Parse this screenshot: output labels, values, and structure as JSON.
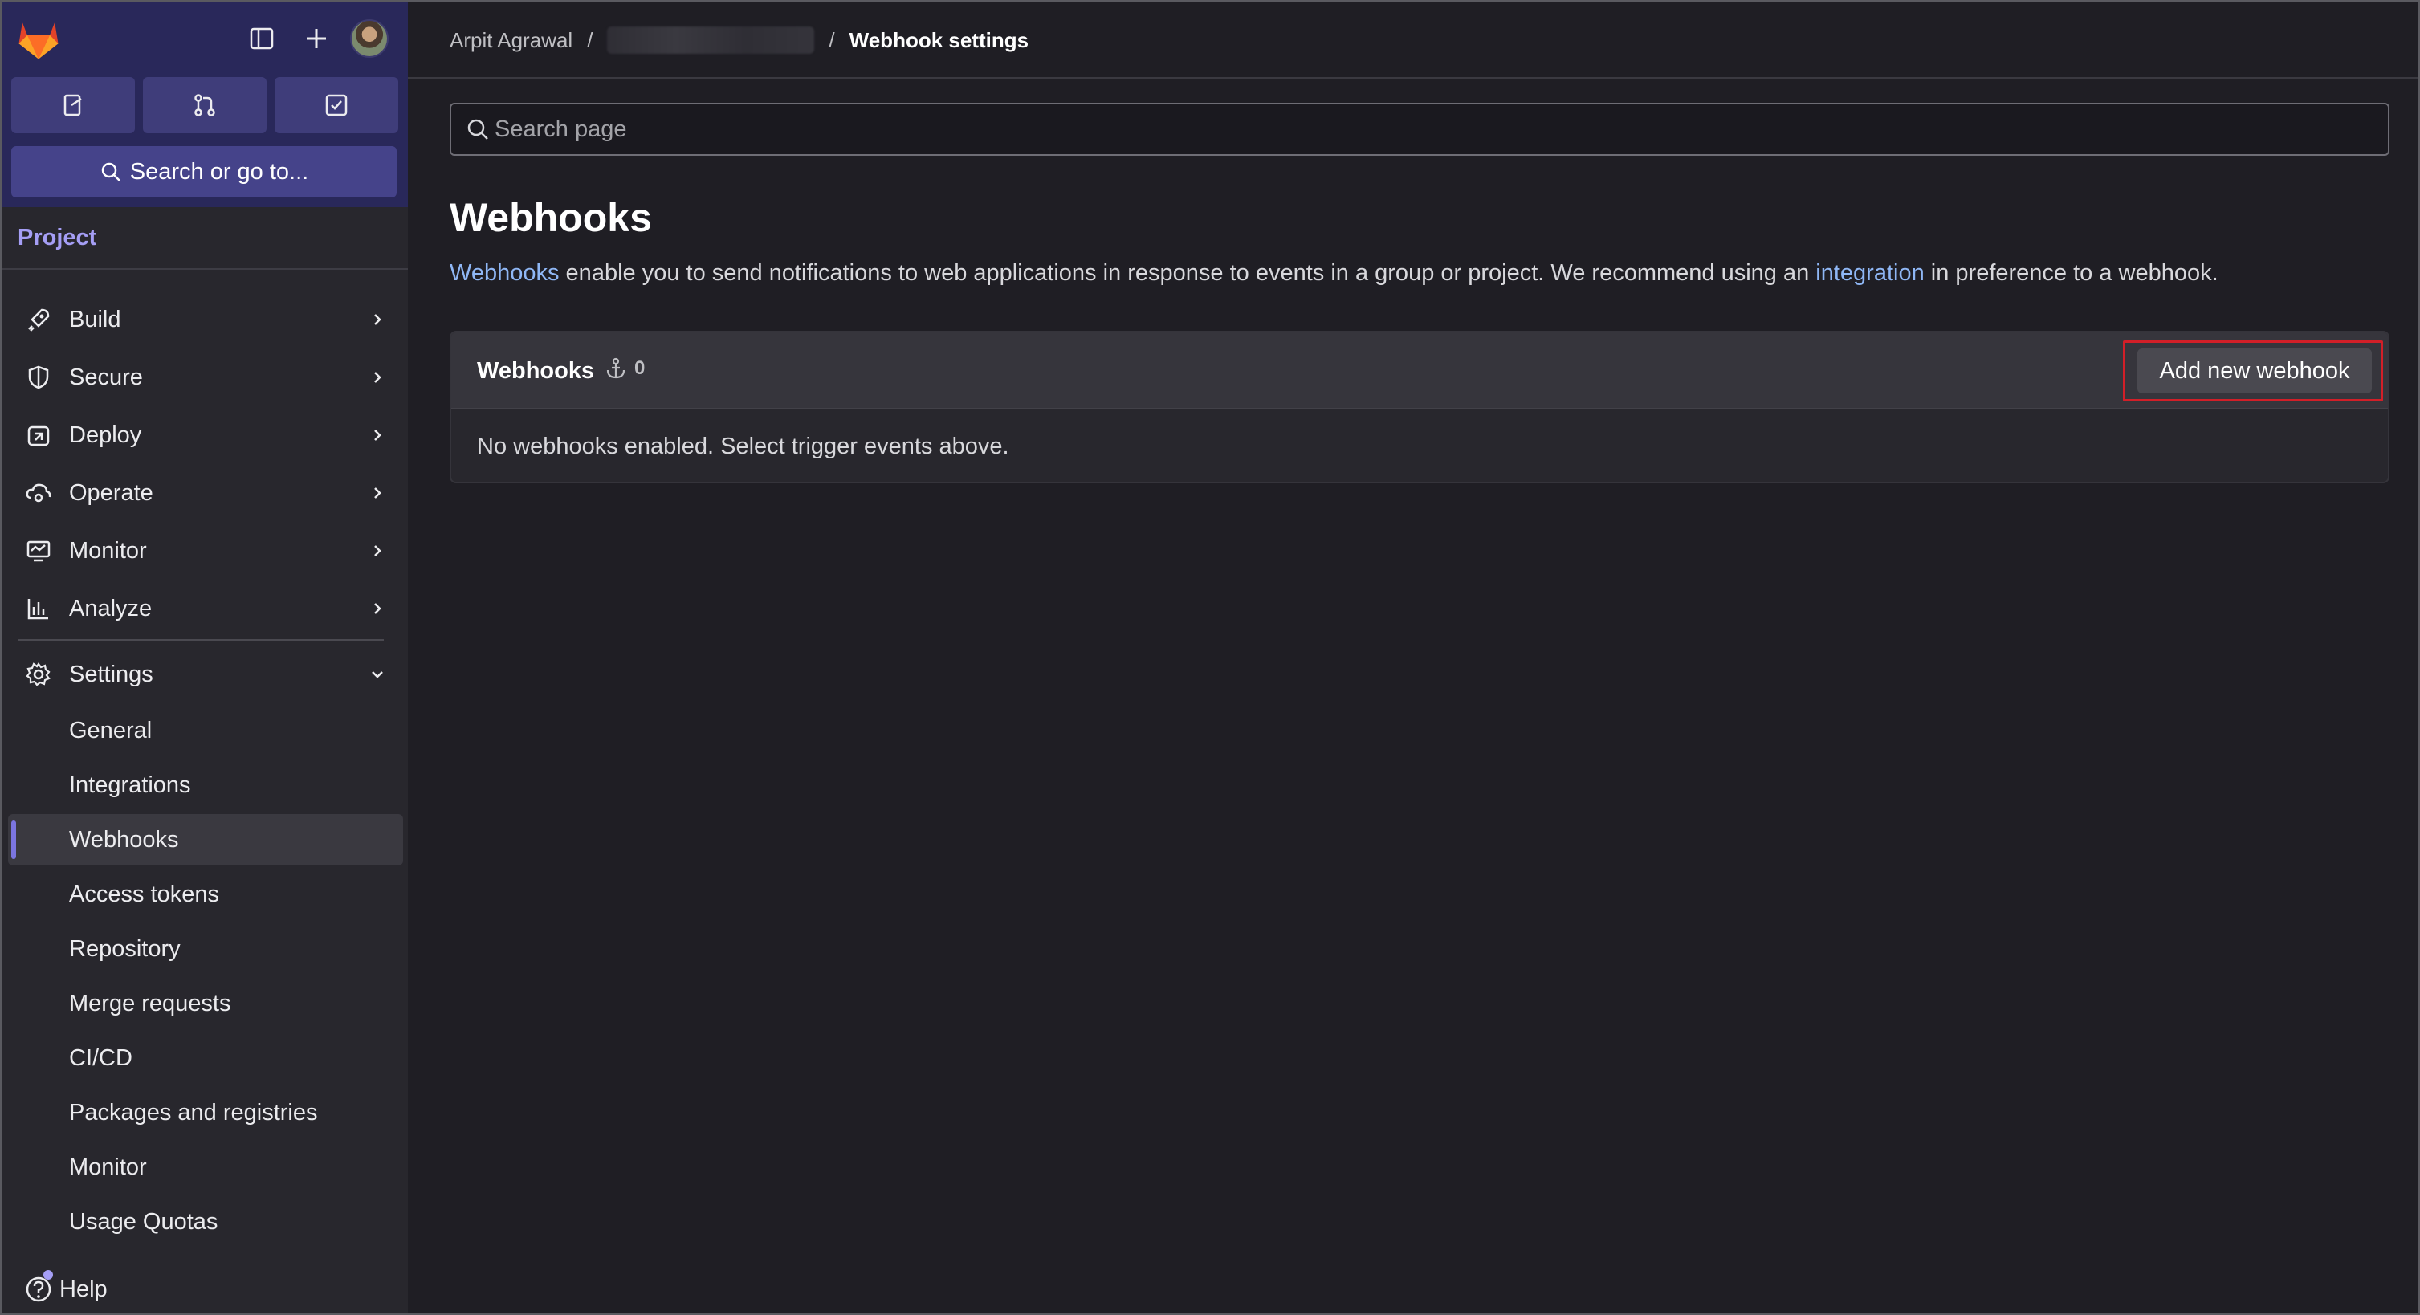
{
  "header": {
    "new_label": "+"
  },
  "sidebar": {
    "search_label": "Search or go to...",
    "section_label": "Project",
    "nav_items": [
      {
        "label": "Build",
        "icon": "rocket-icon"
      },
      {
        "label": "Secure",
        "icon": "shield-icon"
      },
      {
        "label": "Deploy",
        "icon": "deploy-icon"
      },
      {
        "label": "Operate",
        "icon": "cloud-gear-icon"
      },
      {
        "label": "Monitor",
        "icon": "monitor-icon"
      },
      {
        "label": "Analyze",
        "icon": "chart-icon"
      }
    ],
    "settings": {
      "label": "Settings",
      "items": [
        {
          "label": "General"
        },
        {
          "label": "Integrations"
        },
        {
          "label": "Webhooks"
        },
        {
          "label": "Access tokens"
        },
        {
          "label": "Repository"
        },
        {
          "label": "Merge requests"
        },
        {
          "label": "CI/CD"
        },
        {
          "label": "Packages and registries"
        },
        {
          "label": "Monitor"
        },
        {
          "label": "Usage Quotas"
        }
      ]
    },
    "help_label": "Help"
  },
  "breadcrumb": {
    "owner": "Arpit Agrawal",
    "separator": "/",
    "current": "Webhook settings"
  },
  "search": {
    "placeholder": "Search page",
    "value": ""
  },
  "page": {
    "title": "Webhooks",
    "desc_link1": "Webhooks",
    "desc_mid": " enable you to send notifications to web applications in response to events in a group or project. We recommend using an ",
    "desc_link2": "integration",
    "desc_end": " in preference to a webhook."
  },
  "webhooks_card": {
    "title": "Webhooks",
    "count": "0",
    "add_button": "Add new webhook",
    "empty_message": "No webhooks enabled. Select trigger events above."
  },
  "colors": {
    "sidebar_top": "#29285a",
    "accent": "#a59ef5",
    "link": "#8fb7f5",
    "highlight": "#d21f28"
  }
}
